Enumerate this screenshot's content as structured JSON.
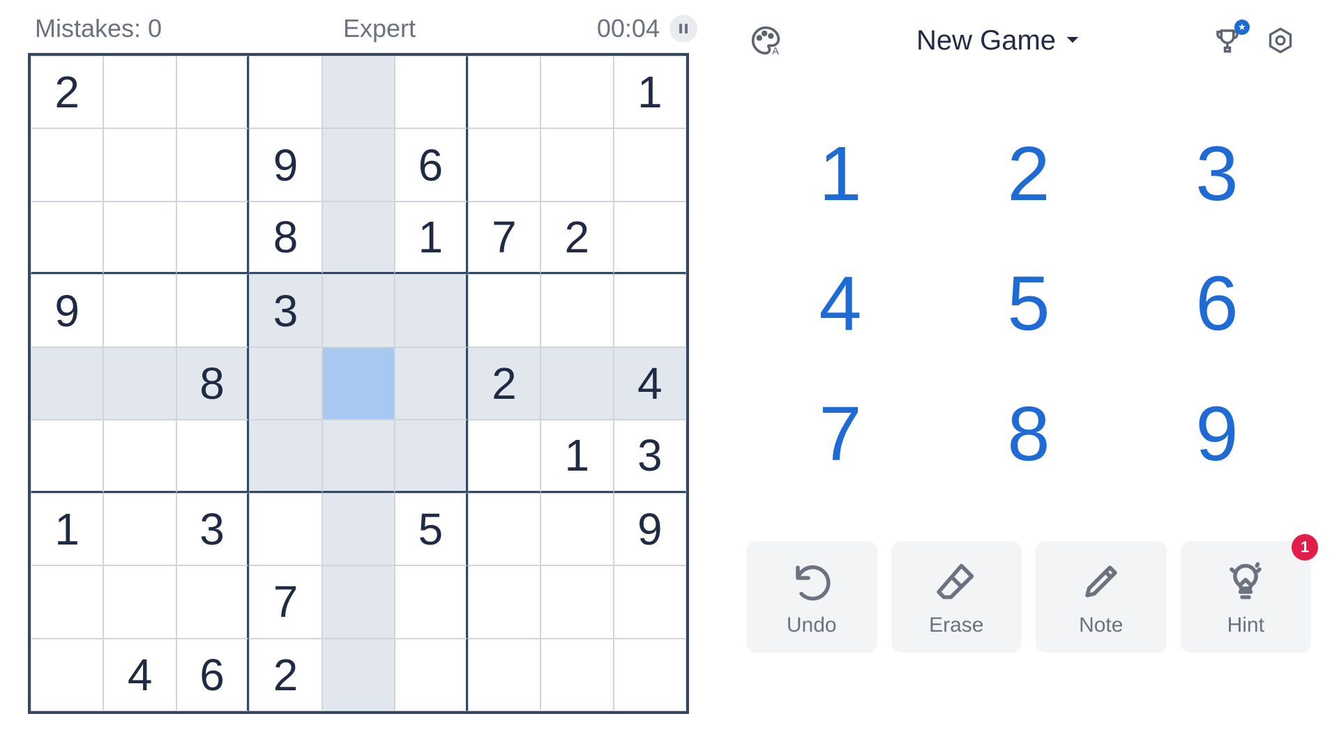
{
  "status": {
    "mistakes_label": "Mistakes: 0",
    "difficulty": "Expert",
    "time": "00:04"
  },
  "board": {
    "selected": {
      "row": 4,
      "col": 4
    },
    "grid": [
      [
        "2",
        "",
        "",
        "",
        "",
        "",
        "",
        "",
        "1"
      ],
      [
        "",
        "",
        "",
        "9",
        "",
        "6",
        "",
        "",
        ""
      ],
      [
        "",
        "",
        "",
        "8",
        "",
        "1",
        "7",
        "2",
        ""
      ],
      [
        "9",
        "",
        "",
        "3",
        "",
        "",
        "",
        "",
        ""
      ],
      [
        "",
        "",
        "8",
        "",
        "",
        "",
        "2",
        "",
        "4"
      ],
      [
        "",
        "",
        "",
        "",
        "",
        "",
        "",
        "1",
        "3"
      ],
      [
        "1",
        "",
        "3",
        "",
        "",
        "5",
        "",
        "",
        "9"
      ],
      [
        "",
        "",
        "",
        "7",
        "",
        "",
        "",
        "",
        ""
      ],
      [
        "",
        "4",
        "6",
        "2",
        "",
        "",
        "",
        "",
        ""
      ]
    ]
  },
  "header": {
    "new_game_label": "New Game"
  },
  "numpad": {
    "numbers": [
      "1",
      "2",
      "3",
      "4",
      "5",
      "6",
      "7",
      "8",
      "9"
    ]
  },
  "actions": {
    "undo_label": "Undo",
    "erase_label": "Erase",
    "note_label": "Note",
    "hint_label": "Hint",
    "hint_badge": "1"
  },
  "colors": {
    "accent": "#1e6bd6",
    "grid_dark": "#344861",
    "highlight": "#e2e7ed",
    "selected": "#a7c8f0",
    "badge": "#e11d48"
  }
}
